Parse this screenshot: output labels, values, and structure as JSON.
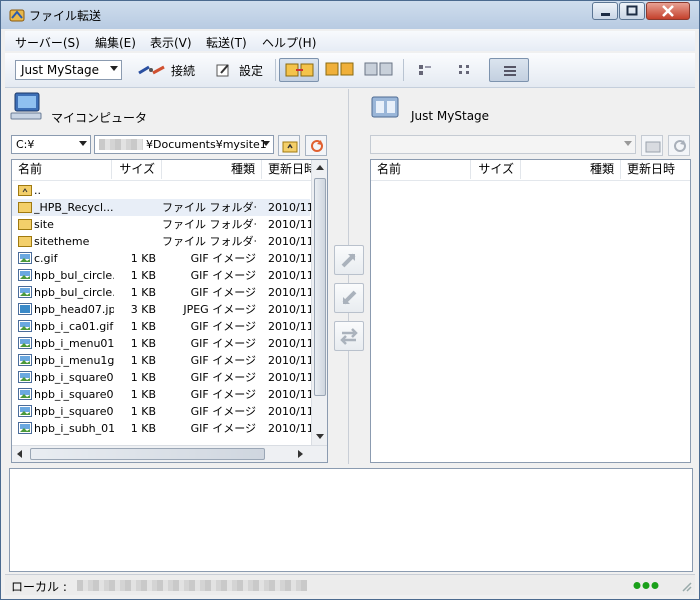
{
  "window": {
    "title": "ファイル転送"
  },
  "menu": [
    {
      "label": "サーバー(S)"
    },
    {
      "label": "編集(E)"
    },
    {
      "label": "表示(V)"
    },
    {
      "label": "転送(T)"
    },
    {
      "label": "ヘルプ(H)"
    }
  ],
  "toolbar": {
    "profile_value": "Just MyStage",
    "connect_label": "接続",
    "settings_label": "設定"
  },
  "local": {
    "title": "マイコンピュータ",
    "drive_value": "C:¥",
    "path_value": "¥Documents¥mysite1",
    "columns": [
      "名前",
      "サイズ",
      "種類",
      "更新日時"
    ],
    "rows": [
      {
        "name": "..",
        "size": "",
        "type": "",
        "date": "",
        "icon": "up-folder-icon"
      },
      {
        "name": "_HPB_Recycl...",
        "size": "",
        "type": "ファイル フォルダー",
        "date": "2010/11",
        "icon": "folder-icon"
      },
      {
        "name": "site",
        "size": "",
        "type": "ファイル フォルダー",
        "date": "2010/11",
        "icon": "folder-icon"
      },
      {
        "name": "sitetheme",
        "size": "",
        "type": "ファイル フォルダー",
        "date": "2010/11",
        "icon": "folder-icon"
      },
      {
        "name": "c.gif",
        "size": "1 KB",
        "type": "GIF イメージ",
        "date": "2010/11",
        "icon": "image-icon"
      },
      {
        "name": "hpb_bul_circle...",
        "size": "1 KB",
        "type": "GIF イメージ",
        "date": "2010/11",
        "icon": "image-icon"
      },
      {
        "name": "hpb_bul_circle...",
        "size": "1 KB",
        "type": "GIF イメージ",
        "date": "2010/11",
        "icon": "image-icon"
      },
      {
        "name": "hpb_head07.jpg",
        "size": "3 KB",
        "type": "JPEG イメージ",
        "date": "2010/11",
        "icon": "photo-icon"
      },
      {
        "name": "hpb_i_ca01.gif",
        "size": "1 KB",
        "type": "GIF イメージ",
        "date": "2010/11",
        "icon": "image-icon"
      },
      {
        "name": "hpb_i_menu01...",
        "size": "1 KB",
        "type": "GIF イメージ",
        "date": "2010/11",
        "icon": "image-icon"
      },
      {
        "name": "hpb_i_menu1g...",
        "size": "1 KB",
        "type": "GIF イメージ",
        "date": "2010/11",
        "icon": "image-icon"
      },
      {
        "name": "hpb_i_square0...",
        "size": "1 KB",
        "type": "GIF イメージ",
        "date": "2010/11",
        "icon": "image-icon"
      },
      {
        "name": "hpb_i_square0...",
        "size": "1 KB",
        "type": "GIF イメージ",
        "date": "2010/11",
        "icon": "image-icon"
      },
      {
        "name": "hpb_i_square0...",
        "size": "1 KB",
        "type": "GIF イメージ",
        "date": "2010/11",
        "icon": "image-icon"
      },
      {
        "name": "hpb_i_subh_01...",
        "size": "1 KB",
        "type": "GIF イメージ",
        "date": "2010/11",
        "icon": "image-icon"
      }
    ]
  },
  "remote": {
    "title": "Just MyStage",
    "path_value": "",
    "columns": [
      "名前",
      "サイズ",
      "種類",
      "更新日時"
    ]
  },
  "status": {
    "label": "ローカル :"
  },
  "colors": {
    "status_ok": "#1aa01a",
    "folder": "#f3cf6a",
    "accent": "#3d6fb6"
  }
}
